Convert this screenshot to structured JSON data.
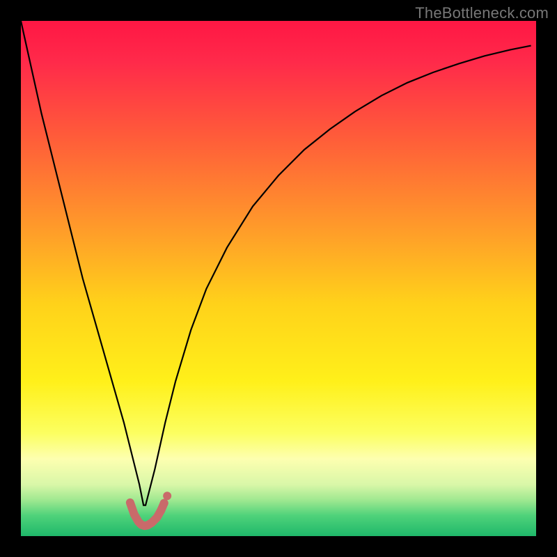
{
  "watermark": "TheBottleneck.com",
  "chart_data": {
    "type": "line",
    "title": "",
    "xlabel": "",
    "ylabel": "",
    "xlim": [
      0,
      100
    ],
    "ylim": [
      0,
      100
    ],
    "grid": false,
    "gradient_stops": [
      {
        "offset": 0.0,
        "color": "#ff1744"
      },
      {
        "offset": 0.08,
        "color": "#ff2a4a"
      },
      {
        "offset": 0.22,
        "color": "#ff5a3a"
      },
      {
        "offset": 0.4,
        "color": "#ff9a2a"
      },
      {
        "offset": 0.55,
        "color": "#ffd21a"
      },
      {
        "offset": 0.7,
        "color": "#fff01a"
      },
      {
        "offset": 0.8,
        "color": "#fcff60"
      },
      {
        "offset": 0.85,
        "color": "#fdffb0"
      },
      {
        "offset": 0.9,
        "color": "#d9f7a8"
      },
      {
        "offset": 0.93,
        "color": "#9fe890"
      },
      {
        "offset": 0.96,
        "color": "#4fd27a"
      },
      {
        "offset": 1.0,
        "color": "#1fb86a"
      }
    ],
    "series": [
      {
        "name": "curve",
        "stroke": "#000000",
        "stroke_width": 2.2,
        "x": [
          0,
          2,
          4,
          6,
          8,
          10,
          12,
          14,
          16,
          18,
          20,
          21,
          22,
          23,
          23.8,
          24.2,
          26,
          28,
          30,
          33,
          36,
          40,
          45,
          50,
          55,
          60,
          65,
          70,
          75,
          80,
          85,
          90,
          95,
          99
        ],
        "y": [
          100,
          91,
          82,
          74,
          66,
          58,
          50,
          43,
          36,
          29,
          22,
          18,
          14,
          10,
          6,
          6,
          13,
          22,
          30,
          40,
          48,
          56,
          64,
          70,
          75,
          79,
          82.5,
          85.5,
          88,
          90,
          91.7,
          93.2,
          94.4,
          95.2
        ]
      },
      {
        "name": "highlight",
        "stroke": "#c96a6a",
        "stroke_width": 12,
        "linecap": "round",
        "x": [
          21.2,
          22.0,
          22.8,
          23.4,
          24.0,
          24.6,
          25.4,
          26.4,
          27.2,
          27.8
        ],
        "y": [
          6.5,
          4.2,
          2.8,
          2.2,
          2.0,
          2.1,
          2.6,
          3.6,
          5.0,
          6.4
        ]
      }
    ],
    "highlight_dots": {
      "color": "#c96a6a",
      "radius": 6,
      "points": [
        {
          "x": 27.2,
          "y": 5.0
        },
        {
          "x": 27.8,
          "y": 6.4
        },
        {
          "x": 28.4,
          "y": 7.8
        }
      ]
    }
  }
}
